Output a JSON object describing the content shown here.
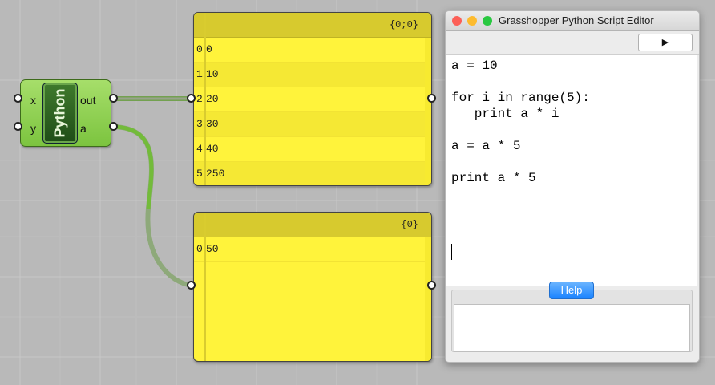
{
  "component": {
    "name": "Python",
    "inputs": [
      "x",
      "y"
    ],
    "outputs": [
      "out",
      "a"
    ]
  },
  "panel_top": {
    "path": "{0;0}",
    "rows": [
      {
        "index": "0",
        "value": "0"
      },
      {
        "index": "1",
        "value": "10"
      },
      {
        "index": "2",
        "value": "20"
      },
      {
        "index": "3",
        "value": "30"
      },
      {
        "index": "4",
        "value": "40"
      },
      {
        "index": "5",
        "value": "250"
      }
    ]
  },
  "panel_bottom": {
    "path": "{0}",
    "rows": [
      {
        "index": "0",
        "value": "50"
      }
    ]
  },
  "editor": {
    "title": "Grasshopper Python Script Editor",
    "run_label": "▶",
    "code": "a = 10\n\nfor i in range(5):\n   print a * i\n\na = a * 5\n\nprint a * 5",
    "help_label": "Help",
    "traffic_colors": {
      "close": "#fc5f57",
      "minimize": "#fdbb2e",
      "zoom": "#29c840"
    }
  },
  "colors": {
    "panel_yellow": "#fff33b",
    "wire_green": "#73bb3a",
    "wire_gray": "#8f9a7a"
  }
}
